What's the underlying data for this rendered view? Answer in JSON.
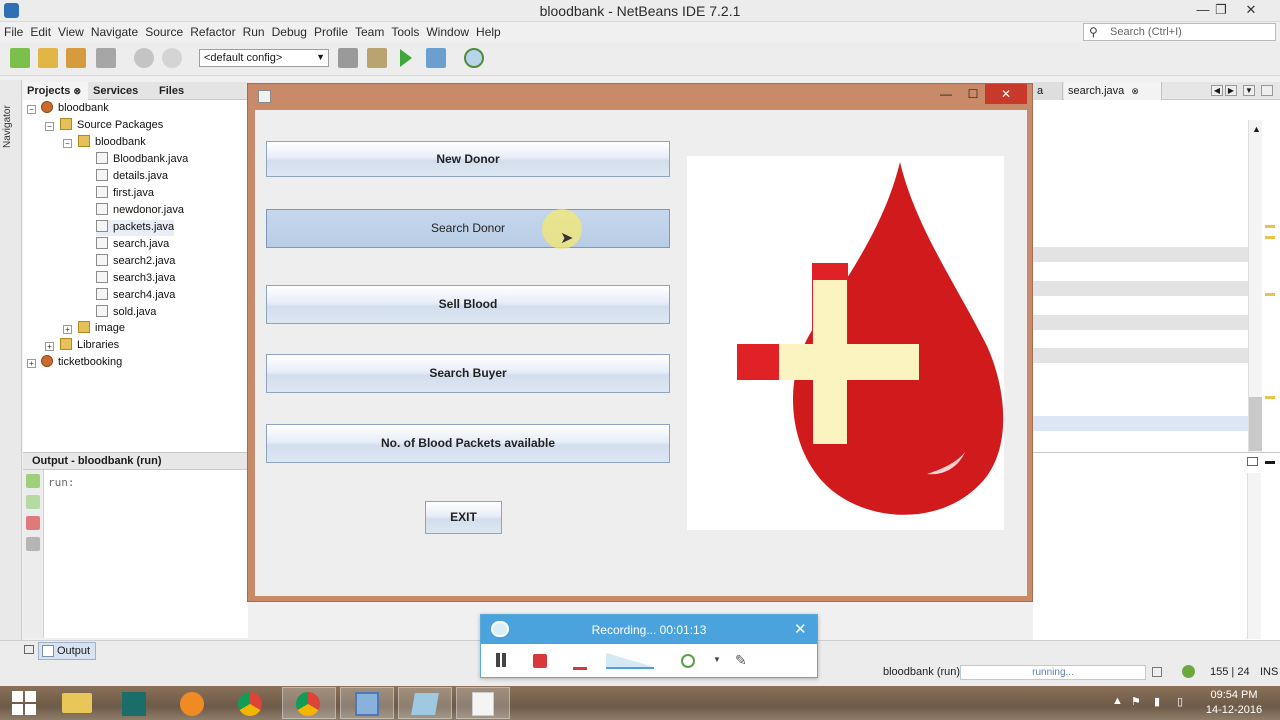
{
  "ide": {
    "title": "bloodbank - NetBeans IDE 7.2.1",
    "menu": [
      "File",
      "Edit",
      "View",
      "Navigate",
      "Source",
      "Refactor",
      "Run",
      "Debug",
      "Profile",
      "Team",
      "Tools",
      "Window",
      "Help"
    ],
    "search_placeholder": "Search (Ctrl+I)",
    "config": "<default config>",
    "navigator_label": "Navigator",
    "project_tabs": [
      "Projects",
      "Services",
      "Files"
    ],
    "tree": {
      "project": "bloodbank",
      "source_packages": "Source Packages",
      "package": "bloodbank",
      "files": [
        "Bloodbank.java",
        "details.java",
        "first.java",
        "newdonor.java",
        "packets.java",
        "search.java",
        "search2.java",
        "search3.java",
        "search4.java",
        "sold.java"
      ],
      "image_folder": "image",
      "libraries": "Libraries",
      "other_project": "ticketbooking"
    },
    "output_title": "Output - bloodbank (run)",
    "output_text": "run:",
    "editor_tabs": [
      "a",
      "search.java"
    ],
    "output_button": "Output",
    "status": {
      "running_project": "bloodbank (run)",
      "progress_text": "running...",
      "position": "155 | 24",
      "mode": "INS"
    }
  },
  "app_window": {
    "buttons": [
      "New Donor",
      "Search Donor",
      "Sell Blood",
      "Search Buyer",
      "No. of Blood Packets available"
    ],
    "exit": "EXIT",
    "colors": {
      "drop": "#d11a1c",
      "cross": "#fbf3c0",
      "cross_back": "#e02226"
    }
  },
  "recorder": {
    "status": "Recording... 00:01:13"
  },
  "taskbar": {
    "time": "09:54 PM",
    "date": "14-12-2016"
  }
}
